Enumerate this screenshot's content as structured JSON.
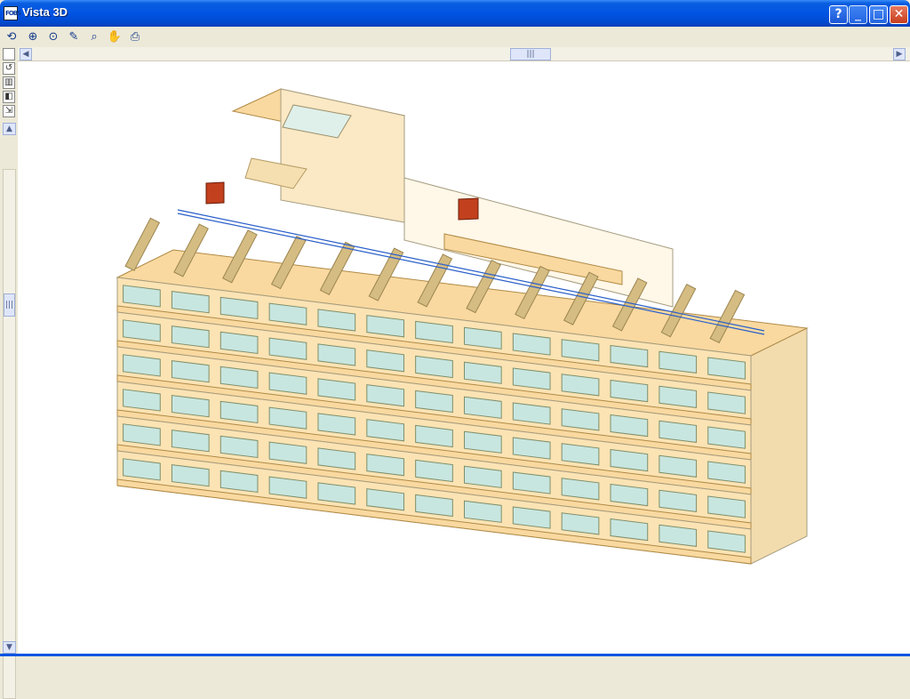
{
  "window": {
    "title": "Vista 3D",
    "app_icon_text": "FOBS",
    "controls": {
      "help": "?",
      "minimize": "_",
      "maximize": "□",
      "close": "✕"
    }
  },
  "toolbar": {
    "tools": [
      {
        "icon": "rotate-icon",
        "glyph": "⟲"
      },
      {
        "icon": "zoom-window-icon",
        "glyph": "⊕"
      },
      {
        "icon": "zoom-icon",
        "glyph": "⊙"
      },
      {
        "icon": "pencil-icon",
        "glyph": "✎"
      },
      {
        "icon": "zoom-search-icon",
        "glyph": "⌕"
      },
      {
        "icon": "pan-hand-icon",
        "glyph": "✋"
      },
      {
        "icon": "print-icon",
        "glyph": "⎙"
      }
    ]
  },
  "side_tools": [
    {
      "icon": "select-box-icon",
      "glyph": ""
    },
    {
      "icon": "undo-icon",
      "glyph": "↺"
    },
    {
      "icon": "layers-icon",
      "glyph": "▥"
    },
    {
      "icon": "view-icon",
      "glyph": "◧"
    },
    {
      "icon": "export-icon",
      "glyph": "⇲"
    }
  ],
  "scrollbar": {
    "left_arrow": "◀",
    "right_arrow": "▶",
    "up_arrow": "▲",
    "down_arrow": "▼",
    "thumb_grip": "|||"
  },
  "colors": {
    "title_blue": "#0054e3",
    "slab_fill": "#f9d9a0",
    "slab_edge": "#b08a45",
    "wall_fill": "#d4bc82",
    "frame": "#a69d80",
    "glass": "#c8e6e0",
    "unit_red": "#c2401d",
    "pipe": "#2a5fc9"
  }
}
